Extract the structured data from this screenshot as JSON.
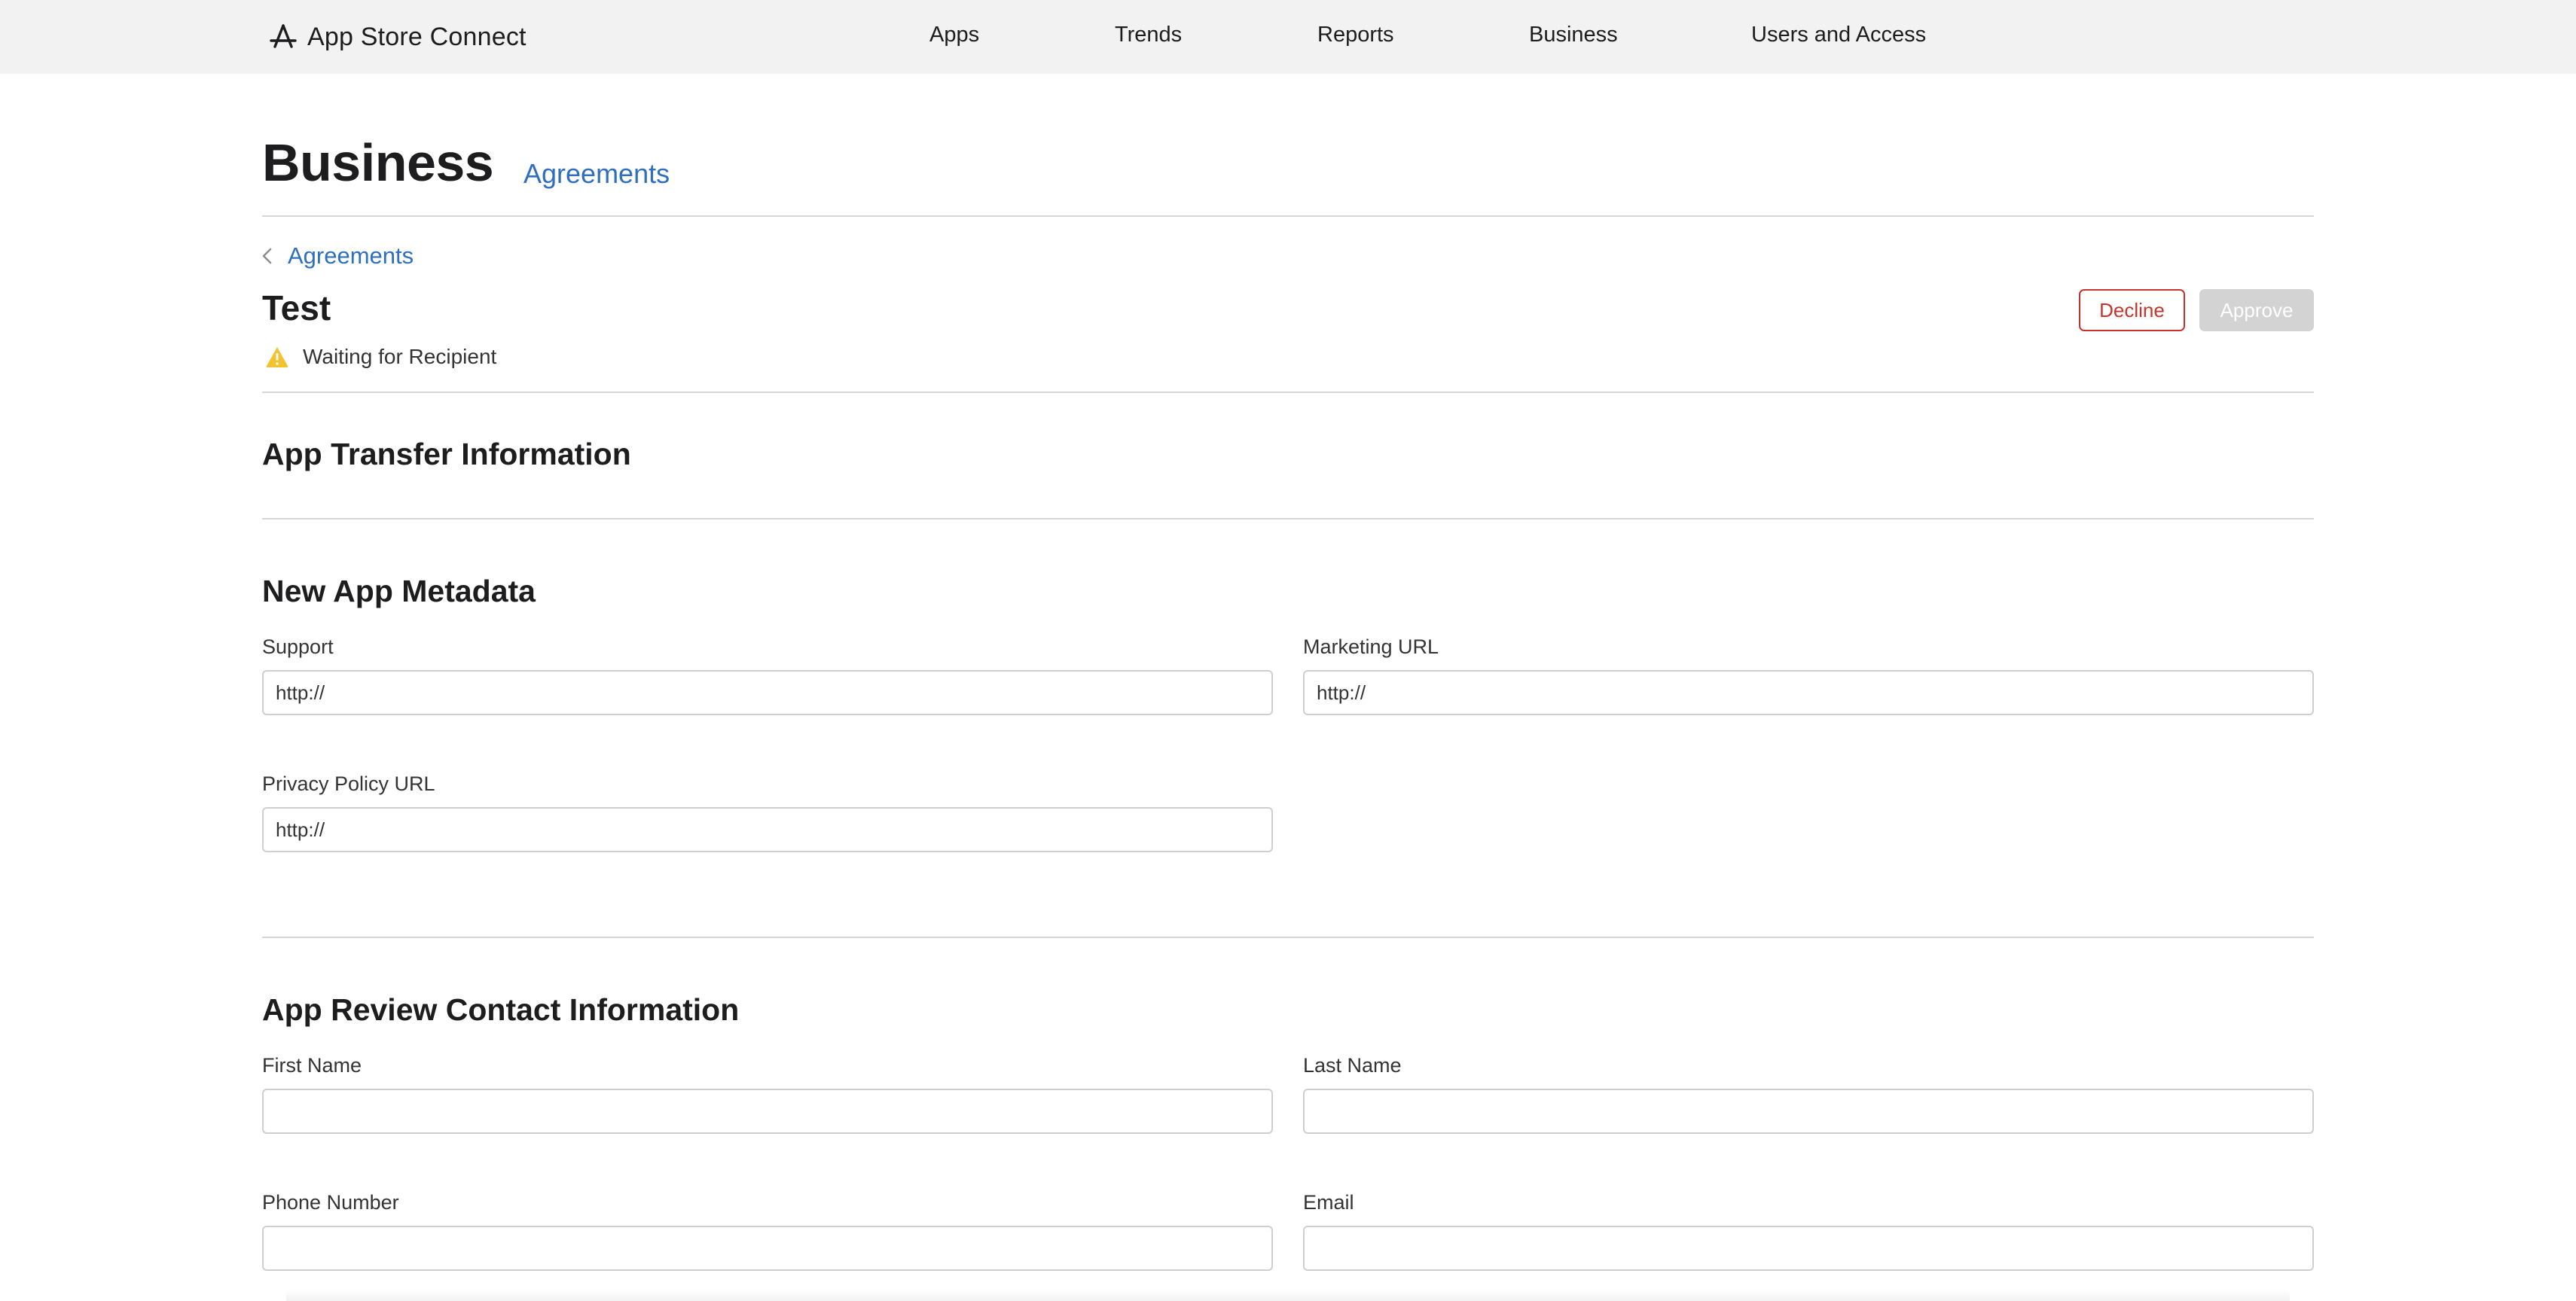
{
  "app": {
    "name": "App Store Connect"
  },
  "nav": {
    "items": [
      {
        "id": "apps",
        "label": "Apps"
      },
      {
        "id": "trends",
        "label": "Trends"
      },
      {
        "id": "reports",
        "label": "Reports"
      },
      {
        "id": "business",
        "label": "Business"
      },
      {
        "id": "users-and-access",
        "label": "Users and Access"
      }
    ]
  },
  "header": {
    "title": "Business",
    "tab": "Agreements"
  },
  "breadcrumb": {
    "back_label": "Agreements"
  },
  "agreement": {
    "title": "Test",
    "status": "Waiting for Recipient",
    "status_icon": "warning-triangle-icon"
  },
  "actions": {
    "decline_label": "Decline",
    "approve_label": "Approve"
  },
  "sections": {
    "transfer_title": "App Transfer Information",
    "metadata": {
      "title": "New App Metadata",
      "support_label": "Support",
      "support_value": "http://",
      "marketing_label": "Marketing URL",
      "marketing_value": "http://",
      "privacy_label": "Privacy Policy URL",
      "privacy_value": "http://"
    },
    "review_contact": {
      "title": "App Review Contact Information",
      "first_name_label": "First Name",
      "first_name_value": "",
      "last_name_label": "Last Name",
      "last_name_value": "",
      "phone_label": "Phone Number",
      "phone_value": "",
      "email_label": "Email",
      "email_value": ""
    }
  },
  "colors": {
    "link": "#2f6fbf",
    "decline": "#c7342b",
    "approve_disabled": "#d3d3d3",
    "warning": "#f2c230",
    "topbar": "#f2f2f2"
  }
}
